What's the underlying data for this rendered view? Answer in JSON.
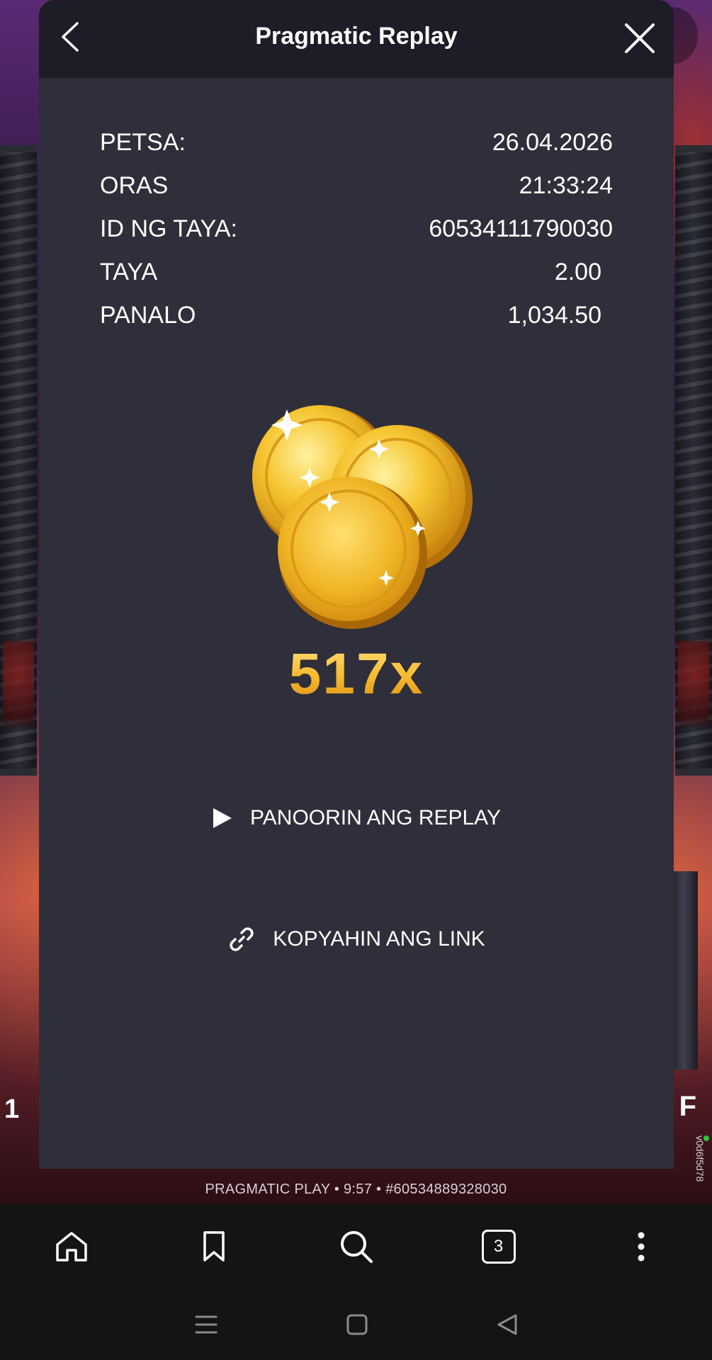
{
  "modal": {
    "title": "Pragmatic Replay"
  },
  "details": [
    {
      "label": "PETSA:",
      "value": "26.04.2026"
    },
    {
      "label": "ORAS",
      "value": "21:33:24"
    },
    {
      "label": "ID NG TAYA:",
      "value": "60534111790030"
    },
    {
      "label": "TAYA",
      "value": "2.00"
    },
    {
      "label": "PANALO",
      "value": "1,034.50"
    }
  ],
  "win": {
    "multiplier": "517x"
  },
  "actions": {
    "replay_label": "PANOORIN ANG REPLAY",
    "copy_label": "KOPYAHIN ANG LINK"
  },
  "game_footer": {
    "info": "PRAGMATIC PLAY • 9:57 • #60534889328030",
    "version": "v0d6f5d78",
    "left_glyph": "1",
    "right_glyph": "F"
  },
  "browser": {
    "tab_count": "3",
    "icons": [
      "home-icon",
      "bookmark-icon",
      "search-icon",
      "tabs-icon",
      "more-icon"
    ]
  },
  "colors": {
    "modal_bg": "#2e2f3b",
    "header_bg": "#1c1d26",
    "accent_gold": "#f6b92c"
  }
}
